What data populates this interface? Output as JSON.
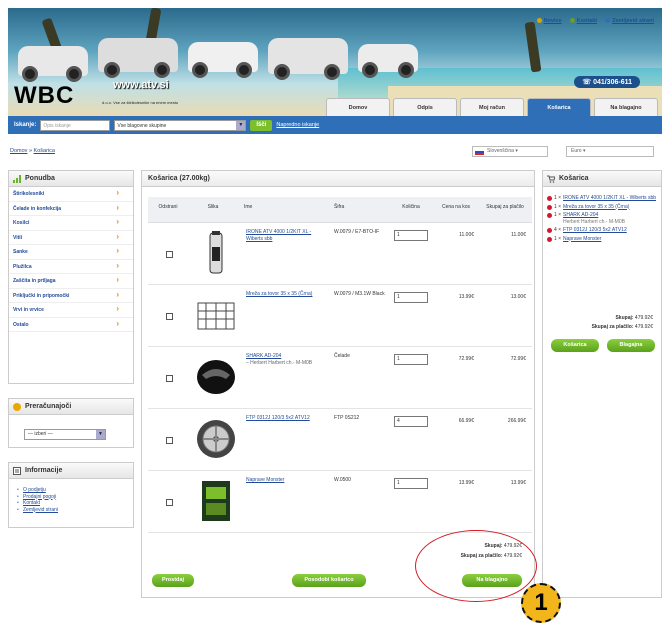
{
  "header": {
    "logo": "WBC",
    "url": "www.atv.si",
    "tagline": "d.o.o. Vse za štirikolesnike na enem mestu",
    "toplinks": [
      "Novice",
      "Kontakt",
      "Zemljevid strani"
    ],
    "phone": "041/306-611",
    "nav_tabs": [
      "Domov",
      "Odpis",
      "Moj račun",
      "Košarica",
      "Na blagajno"
    ],
    "active_tab": "Košarica"
  },
  "search": {
    "label": "Iskanje:",
    "placeholder": "Opis iskanje",
    "group_select": "Vse blagovne skupine",
    "button": "Išči",
    "advanced": "Napredno iskanje"
  },
  "breadcrumb": {
    "home": "Domov",
    "sep": "»",
    "current": "Košarica"
  },
  "language_select": "Slovenščina",
  "currency_select": "Euro",
  "sidebar": {
    "categories_title": "Ponudba",
    "categories": [
      "Štirikolesniki",
      "Čelade in konfekcija",
      "Kosilci",
      "Vitli",
      "Sanke",
      "Plužilca",
      "Zaščita in prtljaga",
      "Priključki in pripomočki",
      "Vrvi in vrvice",
      "Ostalo"
    ],
    "currency_title": "Preračunajoči",
    "currency_value": "— izberi —",
    "info_title": "Informacije",
    "info_links": [
      "O podjetju",
      "Prodajni pogoji",
      "Kontakt",
      "Zemljevid strani"
    ]
  },
  "cart": {
    "title": "Košarica (27.00kg)",
    "columns": [
      "Odstrani",
      "Slika",
      "Ime",
      "Šifra",
      "Količina",
      "Cena na kos",
      "Skupaj za plačilo"
    ],
    "rows": [
      {
        "name": "IRONE ATV 4000 1/2KIT XL - Wiberts sbb",
        "sub": "",
        "code": "W.0079 / E7-BTO-IF",
        "qty": "1",
        "price": "11.00€",
        "total": "11.00€"
      },
      {
        "name": "Mreža za tovor 35 x 35 (Črna)",
        "sub": "",
        "code": "W.0079 / M3.1W Black",
        "qty": "1",
        "price": "13.99€",
        "total": "13.00€"
      },
      {
        "name": "SHARK AD-204",
        "sub": "– Herbert Harbert ch.- M-M0B",
        "code": "Čelade",
        "qty": "1",
        "price": "72.99€",
        "total": "72.99€"
      },
      {
        "name": "FTP 0312J 120/3 5x2 ATV12",
        "sub": "",
        "code": "FTP 0S212",
        "qty": "4",
        "price": "66.99€",
        "total": "266.99€"
      },
      {
        "name": "Naprave Monster",
        "sub": "",
        "code": "W.0500",
        "qty": "1",
        "price": "13.99€",
        "total": "13.99€"
      }
    ],
    "sum_label": "Skupaj:",
    "sum_value": "479.92€",
    "pay_label": "Skupaj za plačilo:",
    "pay_value": "479.92€",
    "btn_back": "Prostdaj",
    "btn_update": "Posodobi košarico",
    "btn_checkout": "Na blagajno"
  },
  "rightcart": {
    "title": "Košarica",
    "items": [
      {
        "qty": "1 ×",
        "name": "IRONE ATV 4000 1/2KIT XL - Wiberts sbb",
        "sub": ""
      },
      {
        "qty": "1 ×",
        "name": "Mreža za tovor 35 x 35 (Črna)",
        "sub": ""
      },
      {
        "qty": "1 ×",
        "name": "SHARK AD-204",
        "sub": "Herbert Harbert ch.- M-M0B"
      },
      {
        "qty": "4 ×",
        "name": "FTP 0312J 120/3 5x2 ATV12",
        "sub": ""
      },
      {
        "qty": "1 ×",
        "name": "Naprave Monster",
        "sub": ""
      }
    ],
    "sum_label": "Skupaj:",
    "sum_value": "479.92€",
    "pay_label": "Skupaj za plačilo:",
    "pay_value": "479.92€",
    "btn_cart": "Košarica",
    "btn_checkout": "Blagajna"
  },
  "annotation_number": "1",
  "colors": {
    "primary": "#2e6fb8",
    "accent_green": "#6cb22a",
    "annotation_red": "#d01d24",
    "badge": "#f2b51b"
  }
}
